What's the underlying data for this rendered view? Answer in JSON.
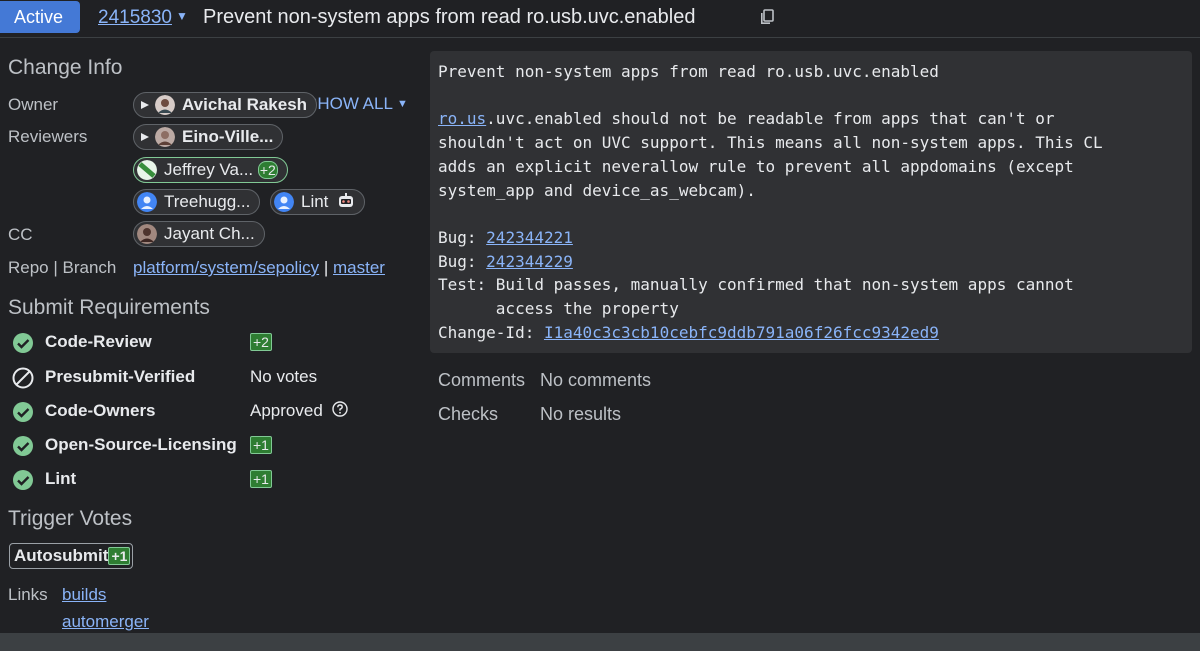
{
  "header": {
    "status": "Active",
    "change_number": "2415830",
    "title": "Prevent non-system apps from read ro.usb.uvc.enabled"
  },
  "change_info": {
    "heading": "Change Info",
    "show_all": "SHOW ALL",
    "owner_label": "Owner",
    "owner": "Avichal Rakesh",
    "reviewers_label": "Reviewers",
    "reviewers": [
      "Eino-Ville...",
      "Jeffrey Va...",
      "Treehugg...",
      "Lint"
    ],
    "reviewer_vote": "+2",
    "cc_label": "CC",
    "cc": "Jayant Ch...",
    "repo_label": "Repo | Branch",
    "repo": "platform/system/sepolicy",
    "separator": "|",
    "branch": "master"
  },
  "submit_requirements": {
    "heading": "Submit Requirements",
    "items": [
      {
        "name": "Code-Review",
        "status": "+2",
        "icon": "check-circle-icon"
      },
      {
        "name": "Presubmit-Verified",
        "status": "No votes",
        "icon": "not-applicable-icon"
      },
      {
        "name": "Code-Owners",
        "status": "Approved",
        "icon": "check-circle-icon"
      },
      {
        "name": "Open-Source-Licensing",
        "status": "+1",
        "icon": "check-circle-icon"
      },
      {
        "name": "Lint",
        "status": "+1",
        "icon": "check-circle-icon"
      }
    ]
  },
  "trigger_votes": {
    "heading": "Trigger Votes",
    "label": "Autosubmit",
    "vote": "+1"
  },
  "links": {
    "label": "Links",
    "items": [
      "builds",
      "automerger"
    ]
  },
  "commit_message": {
    "subject": "Prevent non-system apps from read ro.usb.uvc.enabled",
    "body_link": "ro.us",
    "body_rest": ".uvc.enabled should not be readable from apps that can't or\nshouldn't act on UVC support. This means all non-system apps. This CL\nadds an explicit neverallow rule to prevent all appdomains (except\nsystem_app and device_as_webcam).",
    "bug_label": "Bug: ",
    "bugs": [
      "242344221",
      "242344229"
    ],
    "test_line": "Test: Build passes, manually confirmed that non-system apps cannot\n      access the property",
    "change_id_label": "Change-Id: ",
    "change_id": "I1a40c3c3cb10cebfc9ddb791a06f26fcc9342ed9"
  },
  "summary": {
    "comments_label": "Comments",
    "comments_value": "No comments",
    "checks_label": "Checks",
    "checks_value": "No results"
  },
  "colors": {
    "background": "#202124",
    "accent": "#8ab4f8",
    "status_active": "#4479d6",
    "check_green": "#81c995"
  }
}
